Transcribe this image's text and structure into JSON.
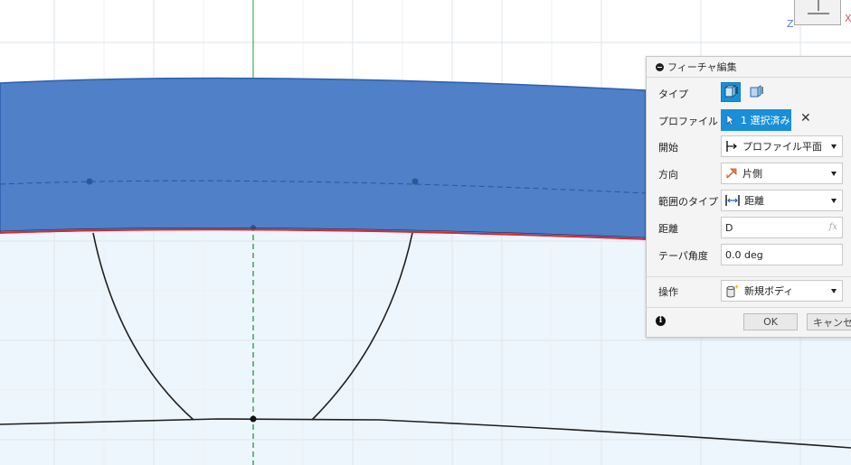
{
  "viewcube": {
    "axis_z": "Z",
    "axis_x": "X"
  },
  "panel": {
    "title": "フィーチャ編集",
    "rows": {
      "type_label": "タイプ",
      "profile_label": "プロファイル",
      "profile_value": "1 選択済み",
      "start_label": "開始",
      "start_value": "プロファイル平面",
      "direction_label": "方向",
      "direction_value": "片側",
      "extent_label": "範囲のタイプ",
      "extent_value": "距離",
      "distance_label": "距離",
      "distance_value": "D",
      "fx_label": "fx",
      "taper_label": "テーパ角度",
      "taper_value": "0.0 deg",
      "operation_label": "操作",
      "operation_value": "新規ボディ"
    },
    "ok_label": "OK",
    "cancel_label": "キャンセル"
  },
  "colors": {
    "body_fill": "#4f80c8",
    "body_edge": "#2e5fae",
    "sketch_fill": "#eef6fd",
    "grid": "#dfe5ea",
    "axis_green": "#3cb44b",
    "accent": "#1a8fd8",
    "profile_red": "#e8202c"
  }
}
